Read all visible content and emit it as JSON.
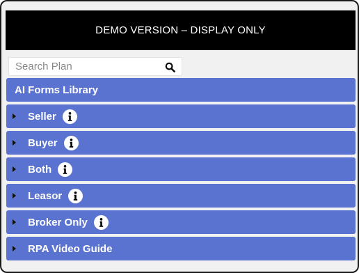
{
  "banner": {
    "text": "DEMO VERSION – DISPLAY ONLY"
  },
  "search": {
    "placeholder": "Search Plan",
    "value": ""
  },
  "library": {
    "title": "AI Forms Library"
  },
  "items": [
    {
      "label": "Seller",
      "has_info": true
    },
    {
      "label": "Buyer",
      "has_info": true
    },
    {
      "label": "Both",
      "has_info": true
    },
    {
      "label": "Leasor",
      "has_info": true
    },
    {
      "label": "Broker Only",
      "has_info": true
    },
    {
      "label": "RPA Video Guide",
      "has_info": false
    }
  ],
  "icons": {
    "search": "search-icon",
    "expand": "caret-right-icon",
    "info": "info-icon"
  },
  "colors": {
    "banner_bg": "#000000",
    "row_bg": "#5a73d1",
    "row_text": "#ffffff",
    "page_bg": "#f1f1f1"
  }
}
